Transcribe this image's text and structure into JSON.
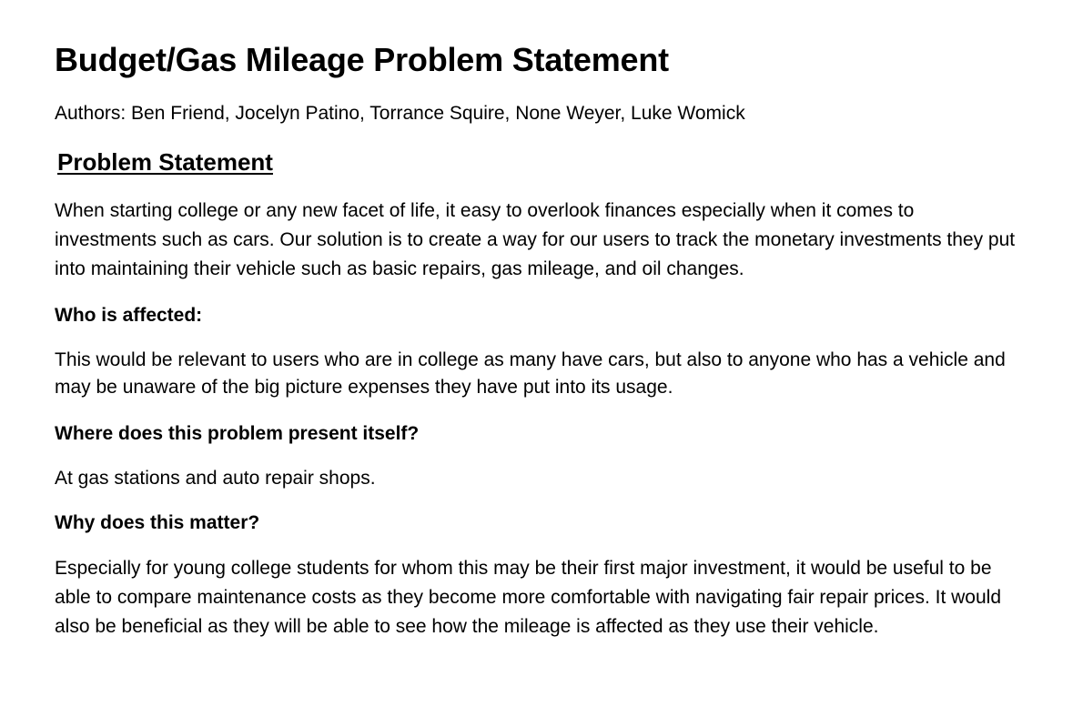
{
  "document": {
    "title": "Budget/Gas Mileage Problem Statement",
    "authors": "Authors: Ben Friend, Jocelyn Patino, Torrance Squire, None Weyer, Luke Womick",
    "section_heading": "Problem Statement",
    "intro": "When starting college or any new facet of life, it easy to overlook finances especially when it comes to investments such as cars. Our solution is to create a way for our users to track the monetary investments they put into maintaining their vehicle such as basic repairs, gas mileage, and oil changes.",
    "sections": [
      {
        "heading": "Who is affected:",
        "body": "This would be relevant to users who are in college as many have cars, but also to anyone who has a vehicle and may be unaware of the big picture expenses they have put into its usage."
      },
      {
        "heading": "Where does this problem present itself?",
        "body": "At gas stations and auto repair shops."
      },
      {
        "heading": "Why does this matter?",
        "body": "Especially for young college students for whom this may be their first major investment, it would be useful to be able to compare maintenance costs as they become more comfortable with navigating fair repair prices. It would also be beneficial as they will be able to see how the mileage is affected as they use their vehicle."
      }
    ]
  }
}
